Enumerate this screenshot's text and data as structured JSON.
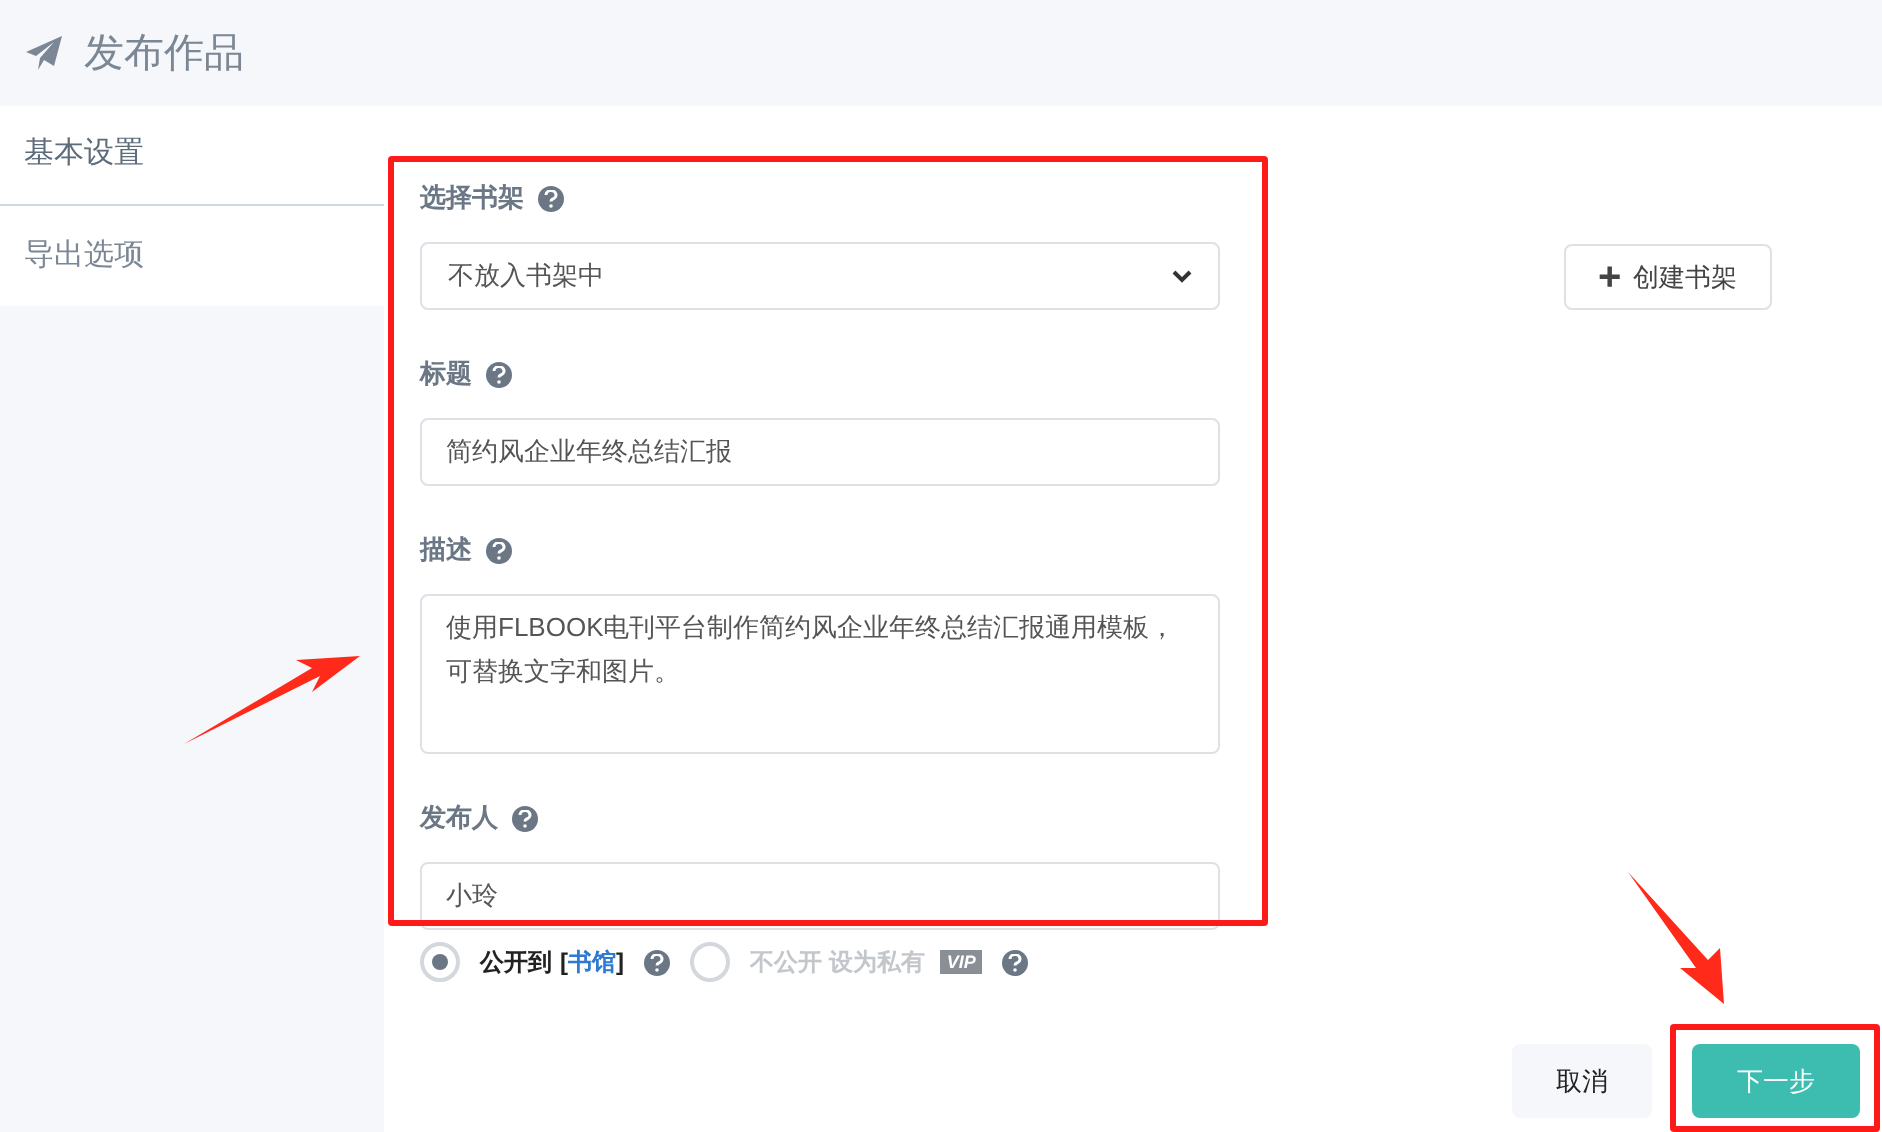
{
  "header": {
    "title": "发布作品"
  },
  "sidebar": {
    "items": [
      {
        "label": "基本设置",
        "selected": true
      },
      {
        "label": "导出选项",
        "selected": false
      }
    ]
  },
  "form": {
    "fields": [
      {
        "kind": "select",
        "label": "选择书架",
        "value": "不放入书架中"
      },
      {
        "kind": "input",
        "label": "标题",
        "value": "简约风企业年终总结汇报"
      },
      {
        "kind": "textarea",
        "label": "描述",
        "value": "使用FLBOOK电刊平台制作简约风企业年终总结汇报通用模板，可替换文字和图片。"
      },
      {
        "kind": "input",
        "label": "发布人",
        "value": "小玲"
      }
    ]
  },
  "create_shelf_button": {
    "icon": "+",
    "label": "创建书架"
  },
  "visibility": [
    {
      "label": "公开到",
      "link_open": "[",
      "link": "书馆",
      "link_close": "]",
      "selected": true
    },
    {
      "label": "不公开 设为私有",
      "badge": "VIP",
      "selected": false
    }
  ],
  "buttons": {
    "cancel": "取消",
    "next": "下一步"
  }
}
